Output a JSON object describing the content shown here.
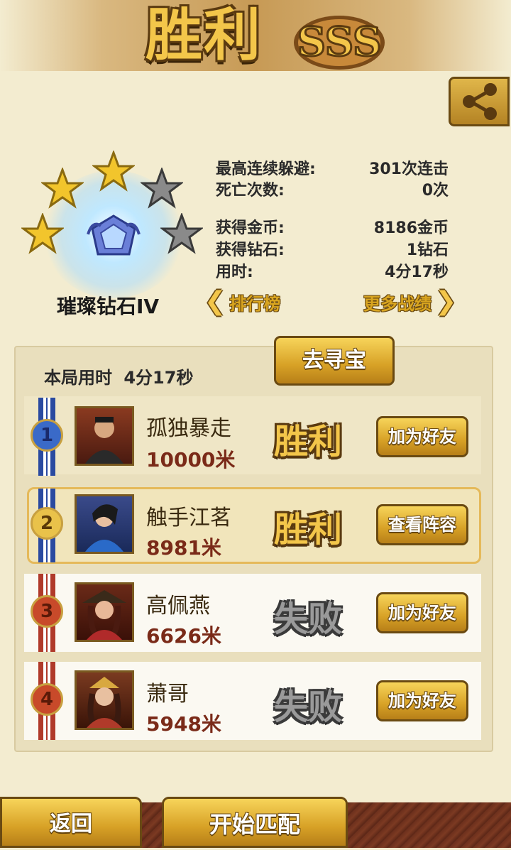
{
  "header": {
    "title": "胜利",
    "grade_badge": "SSS",
    "share_icon": "share-icon"
  },
  "rank": {
    "name": "璀璨钻石IV",
    "stars_filled": 3,
    "stars_total": 5
  },
  "stats": [
    {
      "label": "最高连续躲避:",
      "value": "301次连击"
    },
    {
      "label": "死亡次数:",
      "value": "0次"
    },
    {
      "label": "获得金币:",
      "value": "8186金币"
    },
    {
      "label": "获得钻石:",
      "value": "1钻石"
    },
    {
      "label": "用时:",
      "value": "4分17秒"
    }
  ],
  "nav": {
    "leaderboard": "排行榜",
    "more_records": "更多战绩"
  },
  "panel": {
    "duration_label": "本局用时",
    "duration_value": "4分17秒",
    "treasure_button": "去寻宝"
  },
  "players": [
    {
      "rank": "1",
      "name": "孤独暴走",
      "distance": "10000米",
      "result": "胜利",
      "action": "加为好友"
    },
    {
      "rank": "2",
      "name": "触手江茗",
      "distance": "8981米",
      "result": "胜利",
      "action": "查看阵容"
    },
    {
      "rank": "3",
      "name": "高佩燕",
      "distance": "6626米",
      "result": "失败",
      "action": "加为好友"
    },
    {
      "rank": "4",
      "name": "萧哥",
      "distance": "5948米",
      "result": "失败",
      "action": "加为好友"
    }
  ],
  "footer": {
    "back": "返回",
    "start_match": "开始匹配"
  },
  "colors": {
    "gold": "#f3c64a",
    "win_ribbon": "#2a4aa0",
    "lose_ribbon": "#b03a2a",
    "distance": "#7a2a18"
  }
}
